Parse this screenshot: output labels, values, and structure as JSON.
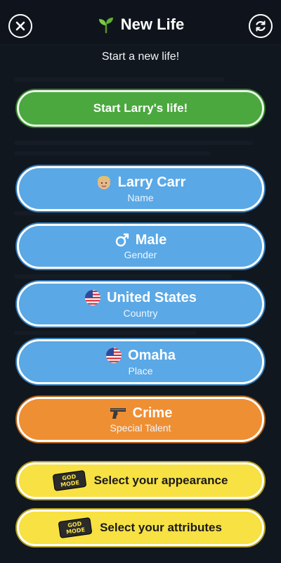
{
  "header": {
    "title": "New Life",
    "subtitle": "Start a new life!"
  },
  "start_button": {
    "label": "Start Larry's life!"
  },
  "options": [
    {
      "value": "Larry Carr",
      "caption": "Name",
      "icon": "face-icon"
    },
    {
      "value": "Male",
      "caption": "Gender",
      "icon": "male-symbol-icon"
    },
    {
      "value": "United States",
      "caption": "Country",
      "icon": "us-flag-icon"
    },
    {
      "value": "Omaha",
      "caption": "Place",
      "icon": "us-flag-icon"
    },
    {
      "value": "Crime",
      "caption": "Special Talent",
      "icon": "pistol-icon"
    }
  ],
  "god_mode": {
    "badge_text": "GOD MODE",
    "appearance_label": "Select your appearance",
    "attributes_label": "Select your attributes"
  },
  "colors": {
    "green": "#4aa83e",
    "blue": "#5aa8e6",
    "orange": "#ef8f33",
    "yellow": "#f7e143"
  }
}
